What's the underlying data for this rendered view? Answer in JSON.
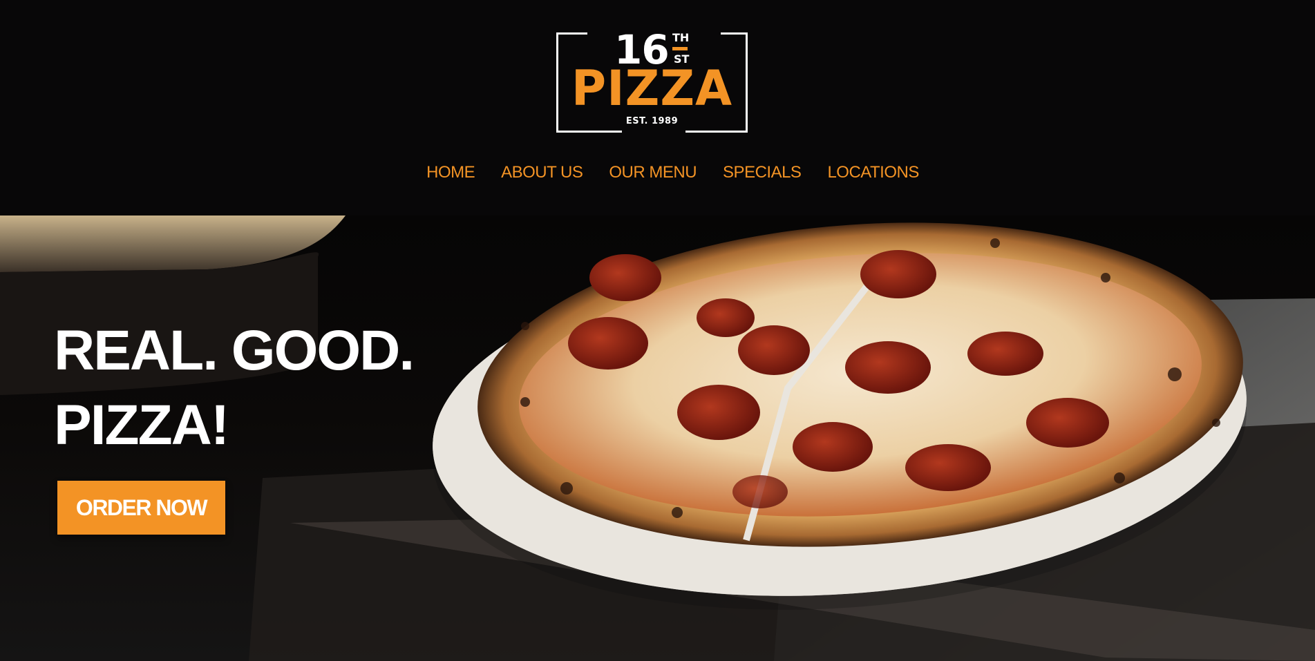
{
  "logo": {
    "number": "16",
    "superscript": "TH",
    "subscript": "ST",
    "word": "PIZZA",
    "established": "EST. 1989"
  },
  "nav": {
    "items": [
      {
        "label": "HOME"
      },
      {
        "label": "ABOUT US"
      },
      {
        "label": "OUR MENU"
      },
      {
        "label": "SPECIALS"
      },
      {
        "label": "LOCATIONS"
      }
    ]
  },
  "hero": {
    "headline_line1": "REAL. GOOD.",
    "headline_line2": "PIZZA!",
    "cta_label": "ORDER NOW",
    "image_subject": "pepperoni-pizza-on-paddle"
  },
  "colors": {
    "accent": "#f39325",
    "background": "#080708",
    "text": "#ffffff"
  }
}
